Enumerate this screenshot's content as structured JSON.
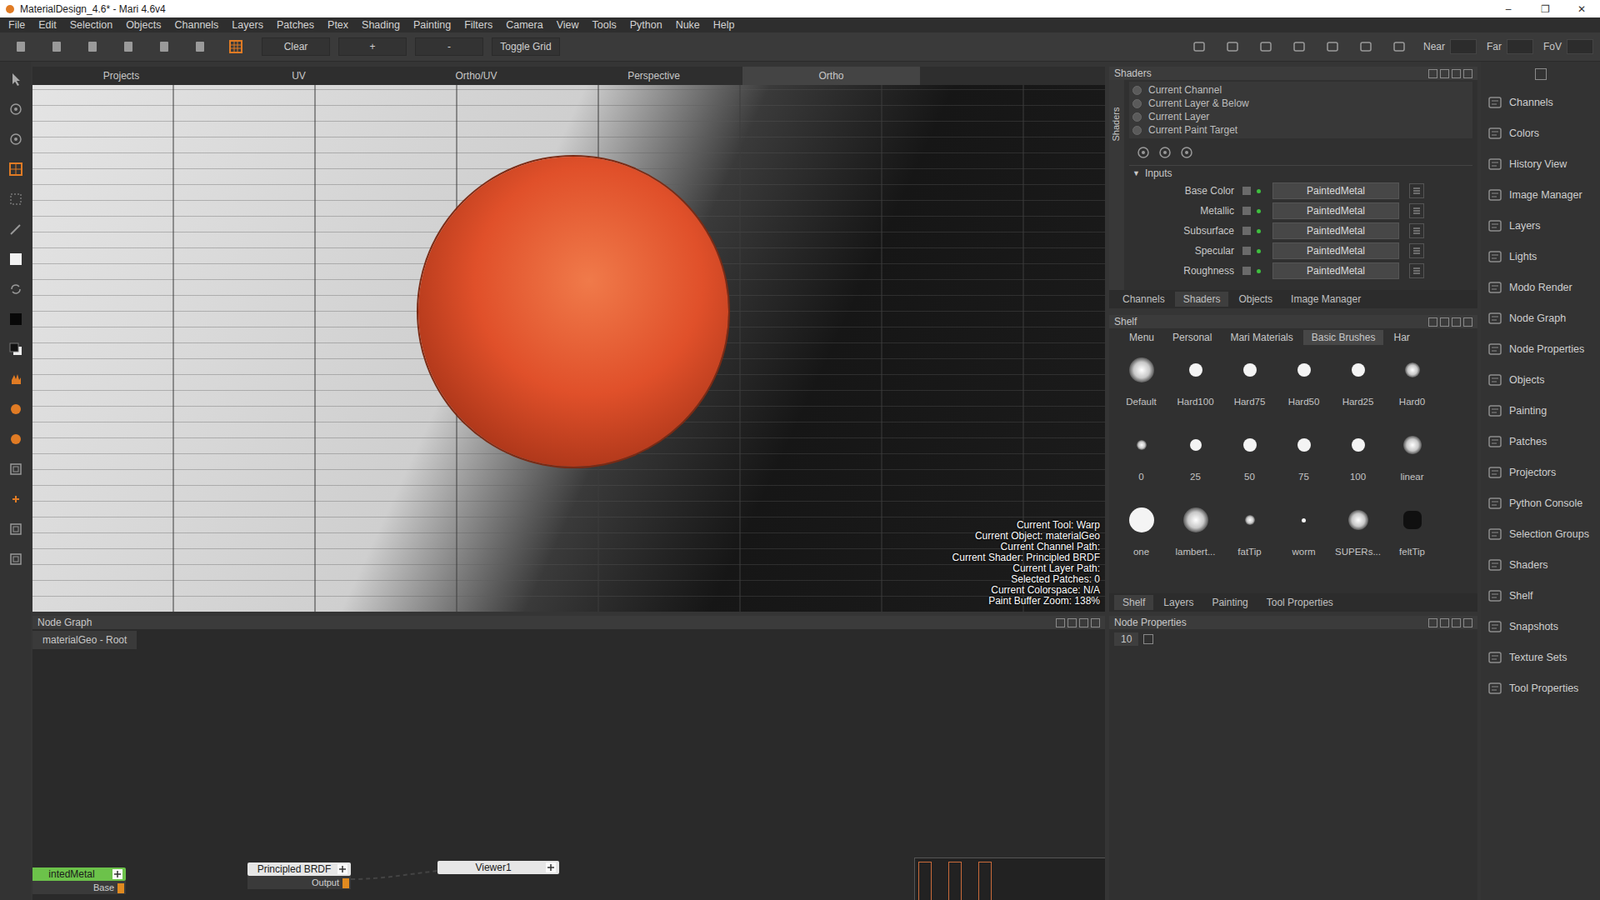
{
  "window": {
    "title": "MaterialDesign_4.6* - Mari 4.6v4",
    "controls": [
      "–",
      "❐",
      "✕"
    ]
  },
  "menu": [
    "File",
    "Edit",
    "Selection",
    "Objects",
    "Channels",
    "Layers",
    "Patches",
    "Ptex",
    "Shading",
    "Painting",
    "Filters",
    "Camera",
    "View",
    "Tools",
    "Python",
    "Nuke",
    "Help"
  ],
  "toolbar": {
    "buttons": [
      "Clear",
      "+",
      "-",
      "Toggle Grid"
    ],
    "camera_fields": [
      "Near",
      "Far",
      "FoV"
    ]
  },
  "viewport": {
    "tabs": [
      {
        "label": "Projects",
        "selected": false
      },
      {
        "label": "UV",
        "selected": false
      },
      {
        "label": "Ortho/UV",
        "selected": false
      },
      {
        "label": "Perspective",
        "selected": false
      },
      {
        "label": "Ortho",
        "selected": true
      }
    ],
    "status": [
      "Current Tool: Warp",
      "Current Object: materialGeo",
      "Current Channel Path:",
      "Current Shader: Principled BRDF",
      "Current Layer Path:",
      "Selected Patches: 0",
      "Current Colorspace: N/A",
      "Paint Buffer Zoom: 138%"
    ]
  },
  "shaders_panel": {
    "title": "Shaders",
    "side_label": "Shaders",
    "modes": [
      {
        "label": "Current Channel",
        "selected": false
      },
      {
        "label": "Current Layer & Below",
        "selected": false
      },
      {
        "label": "Current Layer",
        "selected": false
      },
      {
        "label": "Current Paint Target",
        "selected": false
      }
    ],
    "inputs_title": "Inputs",
    "inputs_expanded": true,
    "inputs": [
      {
        "name": "Base Color",
        "value": "PaintedMetal"
      },
      {
        "name": "Metallic",
        "value": "PaintedMetal"
      },
      {
        "name": "Subsurface",
        "value": "PaintedMetal"
      },
      {
        "name": "Specular",
        "value": "PaintedMetal"
      },
      {
        "name": "Roughness",
        "value": "PaintedMetal"
      }
    ],
    "tabs": [
      {
        "label": "Channels",
        "selected": false
      },
      {
        "label": "Shaders",
        "selected": true
      },
      {
        "label": "Objects",
        "selected": false
      },
      {
        "label": "Image Manager",
        "selected": false
      }
    ]
  },
  "shelf": {
    "title": "Shelf",
    "tabs": [
      {
        "label": "Menu",
        "selected": false
      },
      {
        "label": "Personal",
        "selected": false
      },
      {
        "label": "Mari Materials",
        "selected": false
      },
      {
        "label": "Basic Brushes",
        "selected": true
      },
      {
        "label": "Har",
        "selected": false
      }
    ],
    "brushes": [
      {
        "label": "Default",
        "kind": "soft"
      },
      {
        "label": "Hard100",
        "kind": "hard"
      },
      {
        "label": "Hard75",
        "kind": "hard"
      },
      {
        "label": "Hard50",
        "kind": "hard"
      },
      {
        "label": "Hard25",
        "kind": "hard"
      },
      {
        "label": "Hard0",
        "kind": "soft"
      },
      {
        "label": "0",
        "kind": "soft"
      },
      {
        "label": "25",
        "kind": "hard"
      },
      {
        "label": "50",
        "kind": "hard"
      },
      {
        "label": "75",
        "kind": "hard"
      },
      {
        "label": "100",
        "kind": "hard"
      },
      {
        "label": "linear",
        "kind": "soft"
      },
      {
        "label": "one",
        "kind": "hard"
      },
      {
        "label": "lambert...",
        "kind": "soft"
      },
      {
        "label": "fatTip",
        "kind": "soft"
      },
      {
        "label": "worm",
        "kind": "hard"
      },
      {
        "label": "SUPERs...",
        "kind": "soft"
      },
      {
        "label": "feltTip",
        "kind": "stamp"
      }
    ],
    "bottom_tabs": [
      {
        "label": "Shelf",
        "selected": true
      },
      {
        "label": "Layers",
        "selected": false
      },
      {
        "label": "Painting",
        "selected": false
      },
      {
        "label": "Tool Properties",
        "selected": false
      }
    ]
  },
  "sidebar": {
    "items": [
      "Channels",
      "Colors",
      "History View",
      "Image Manager",
      "Layers",
      "Lights",
      "Modo Render",
      "Node Graph",
      "Node Properties",
      "Objects",
      "Painting",
      "Patches",
      "Projectors",
      "Python Console",
      "Selection Groups",
      "Shaders",
      "Shelf",
      "Snapshots",
      "Texture Sets",
      "Tool Properties"
    ]
  },
  "node_graph": {
    "title": "Node Graph",
    "breadcrumb": "materialGeo - Root",
    "nodes": [
      {
        "label": "intedMetal",
        "port": "Base",
        "color": "#6cc24a"
      },
      {
        "label": "Principled BRDF",
        "port": "Output",
        "color": "#e6e6e6"
      },
      {
        "label": "Viewer1",
        "port": "",
        "color": "#e6e6e6"
      }
    ]
  },
  "node_properties": {
    "title": "Node Properties",
    "value": "10"
  }
}
